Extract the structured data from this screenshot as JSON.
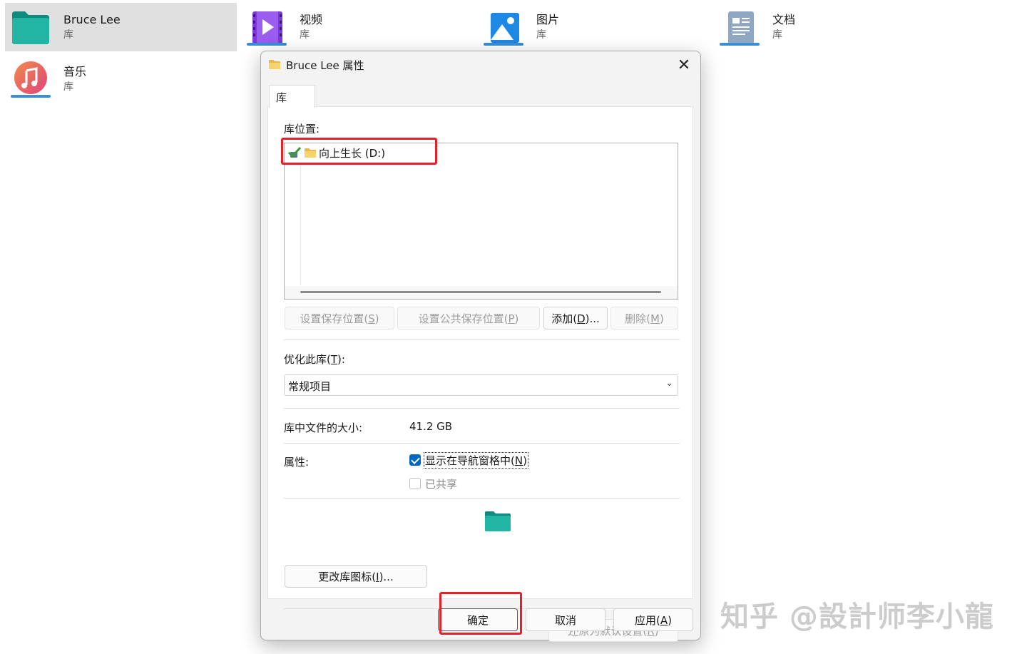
{
  "libraries": [
    {
      "name": "Bruce Lee",
      "sub": "库",
      "icon": "green-folder-icon",
      "selected": true
    },
    {
      "name": "视频",
      "sub": "库",
      "icon": "video-library-icon"
    },
    {
      "name": "图片",
      "sub": "库",
      "icon": "pictures-library-icon"
    },
    {
      "name": "文档",
      "sub": "库",
      "icon": "documents-library-icon"
    },
    {
      "name": "音乐",
      "sub": "库",
      "icon": "music-library-icon"
    }
  ],
  "dialog": {
    "title": "Bruce Lee 属性",
    "close_glyph": "✕",
    "tab_label": "库",
    "locations_label": "库位置:",
    "locations": [
      {
        "label": "向上生长 (D:)"
      }
    ],
    "buttons": {
      "set_save_location": "设置保存位置(S)",
      "set_save_location_key": "S",
      "set_public_save_location": "设置公共保存位置(P)",
      "set_public_save_location_key": "P",
      "add": "添加(D)...",
      "add_key": "D",
      "remove": "删除(M)",
      "remove_key": "M",
      "change_icon": "更改库图标(I)...",
      "change_icon_key": "I",
      "restore_defaults": "还原为默认设置(R)",
      "restore_defaults_key": "R",
      "ok": "确定",
      "cancel": "取消",
      "apply": "应用(A)",
      "apply_key": "A"
    },
    "optimize_label": "优化此库(T):",
    "optimize_key": "T",
    "optimize_value": "常规项目",
    "size_label": "库中文件的大小:",
    "size_value": "41.2 GB",
    "attributes_label": "属性:",
    "show_in_nav_label": "显示在导航窗格中(N)",
    "show_in_nav_key": "N",
    "show_in_nav_checked": true,
    "shared_label": "已共享",
    "shared_checked": false
  },
  "watermark": "知乎 @設計师李小龍",
  "colors": {
    "accent": "#0067c0",
    "highlight_box": "#e3212b",
    "selected_tile": "#e0e0e0",
    "library_folder": "#1aa89a"
  }
}
